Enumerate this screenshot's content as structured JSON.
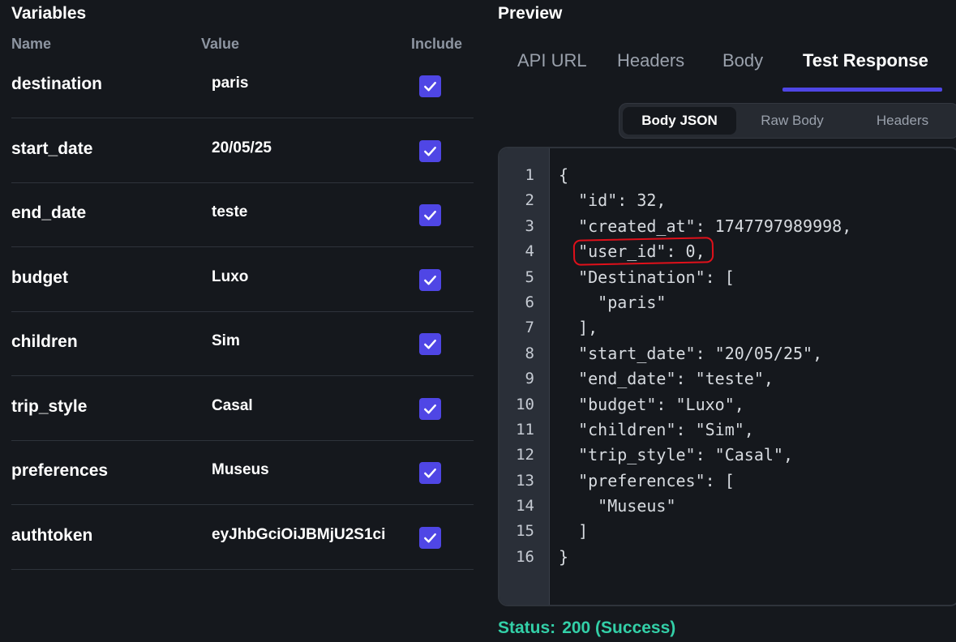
{
  "variables": {
    "title": "Variables",
    "columns": {
      "name": "Name",
      "value": "Value",
      "include": "Include"
    },
    "rows": [
      {
        "name": "destination",
        "value": "paris",
        "include": true
      },
      {
        "name": "start_date",
        "value": "20/05/25",
        "include": true
      },
      {
        "name": "end_date",
        "value": "teste",
        "include": true
      },
      {
        "name": "budget",
        "value": "Luxo",
        "include": true
      },
      {
        "name": "children",
        "value": "Sim",
        "include": true
      },
      {
        "name": "trip_style",
        "value": "Casal",
        "include": true
      },
      {
        "name": "preferences",
        "value": "Museus",
        "include": true
      },
      {
        "name": "authtoken",
        "value": "eyJhbGciOiJBMjU2S1ci",
        "include": true
      }
    ]
  },
  "preview": {
    "title": "Preview",
    "tabs": [
      {
        "label": "API URL",
        "active": false
      },
      {
        "label": "Headers",
        "active": false
      },
      {
        "label": "Body",
        "active": false
      },
      {
        "label": "Test Response",
        "active": true
      }
    ],
    "subtabs": [
      {
        "label": "Body JSON",
        "active": true
      },
      {
        "label": "Raw Body",
        "active": false
      },
      {
        "label": "Headers",
        "active": false
      }
    ],
    "code_lines": [
      {
        "n": "1",
        "text": "{"
      },
      {
        "n": "2",
        "text": "  \"id\": 32,"
      },
      {
        "n": "3",
        "text": "  \"created_at\": 1747797989998,"
      },
      {
        "n": "4",
        "text": "  \"user_id\": 0,"
      },
      {
        "n": "5",
        "text": "  \"Destination\": ["
      },
      {
        "n": "6",
        "text": "    \"paris\""
      },
      {
        "n": "7",
        "text": "  ],"
      },
      {
        "n": "8",
        "text": "  \"start_date\": \"20/05/25\","
      },
      {
        "n": "9",
        "text": "  \"end_date\": \"teste\","
      },
      {
        "n": "10",
        "text": "  \"budget\": \"Luxo\","
      },
      {
        "n": "11",
        "text": "  \"children\": \"Sim\","
      },
      {
        "n": "12",
        "text": "  \"trip_style\": \"Casal\","
      },
      {
        "n": "13",
        "text": "  \"preferences\": ["
      },
      {
        "n": "14",
        "text": "    \"Museus\""
      },
      {
        "n": "15",
        "text": "  ]"
      },
      {
        "n": "16",
        "text": "}"
      }
    ],
    "status_label": "Status:",
    "status_value": "200 (Success)"
  },
  "colors": {
    "background": "#15181d",
    "accent": "#4f46e5",
    "status": "#33d0a8",
    "annotation": "#e0101a"
  }
}
